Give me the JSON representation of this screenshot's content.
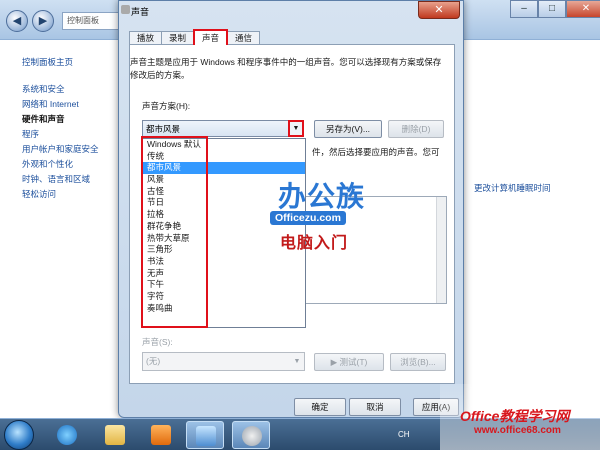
{
  "control_panel": {
    "address_text": "控制面板",
    "nav": [
      {
        "label": "控制面板主页"
      },
      {
        "label": "系统和安全"
      },
      {
        "label": "网络和 Internet"
      },
      {
        "label": "硬件和声音"
      },
      {
        "label": "程序"
      },
      {
        "label": "用户帐户和家庭安全"
      },
      {
        "label": "外观和个性化"
      },
      {
        "label": "时钟、语言和区域"
      },
      {
        "label": "轻松访问"
      }
    ],
    "right_link": "更改计算机睡眠时间"
  },
  "dialog": {
    "title": "声音",
    "close_glyph": "✕",
    "tabs": [
      {
        "label": "播放"
      },
      {
        "label": "录制"
      },
      {
        "label": "声音"
      },
      {
        "label": "通信"
      }
    ],
    "description": "声音主题是应用于 Windows 和程序事件中的一组声音。您可以选择现有方案或保存修改后的方案。",
    "scheme_label": "声音方案(H):",
    "scheme_value": "都市风景",
    "save_as_label": "另存为(V)...",
    "delete_label": "删除(D)",
    "partial_desc": "件，然后选择要应用的声音。您可",
    "sound_label": "声音(S):",
    "sound_value": "(无)",
    "test_label": "▶ 测试(T)",
    "browse_label": "浏览(B)...",
    "ok_label": "确定",
    "cancel_label": "取消",
    "apply_label": "应用(A)",
    "dropdown_items": [
      {
        "label": "Windows 默认"
      },
      {
        "label": "传统"
      },
      {
        "label": "都市风景"
      },
      {
        "label": "风景"
      },
      {
        "label": "古怪"
      },
      {
        "label": "节日"
      },
      {
        "label": "拉格"
      },
      {
        "label": "群花争艳"
      },
      {
        "label": "热带大草原"
      },
      {
        "label": "三角形"
      },
      {
        "label": "书法"
      },
      {
        "label": "无声"
      },
      {
        "label": "下午"
      },
      {
        "label": "字符"
      },
      {
        "label": "奏鸣曲"
      }
    ],
    "selected_index": 2
  },
  "watermark": {
    "brand": "办公族",
    "url": "Officezu.com",
    "sub": "电脑入门",
    "brand2": "Office教程学习网",
    "url2": "www.office68.com"
  },
  "taskbar": {
    "lang": "CH"
  },
  "colors": {
    "highlight": "#3399ff",
    "annotation_red": "#e0101a",
    "link_blue": "#1c4f9c"
  }
}
